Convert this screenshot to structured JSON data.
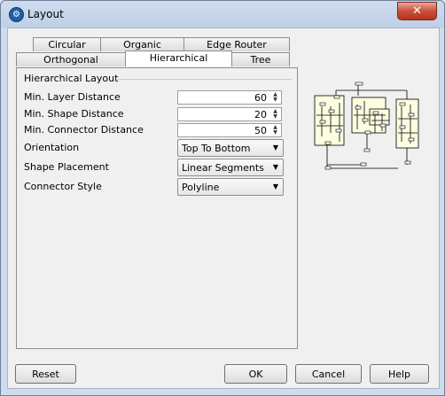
{
  "window": {
    "title": "Layout",
    "close_glyph": "✕"
  },
  "tabs_row1": [
    {
      "label": "Circular"
    },
    {
      "label": "Organic"
    },
    {
      "label": "Edge Router"
    }
  ],
  "tabs_row2": [
    {
      "label": "Orthogonal"
    },
    {
      "label": "Hierarchical",
      "active": true
    },
    {
      "label": "Tree"
    }
  ],
  "group": {
    "title": "Hierarchical Layout"
  },
  "fields": {
    "min_layer_distance": {
      "label": "Min. Layer Distance",
      "value": "60"
    },
    "min_shape_distance": {
      "label": "Min. Shape Distance",
      "value": "20"
    },
    "min_connector_distance": {
      "label": "Min. Connector Distance",
      "value": "50"
    },
    "orientation": {
      "label": "Orientation",
      "value": "Top To Bottom"
    },
    "shape_placement": {
      "label": "Shape Placement",
      "value": "Linear Segments"
    },
    "connector_style": {
      "label": "Connector Style",
      "value": "Polyline"
    }
  },
  "buttons": {
    "reset": "Reset",
    "ok": "OK",
    "cancel": "Cancel",
    "help": "Help"
  },
  "colors": {
    "accent": "#1f5fa8",
    "preview_fill": "#fdfde0"
  }
}
